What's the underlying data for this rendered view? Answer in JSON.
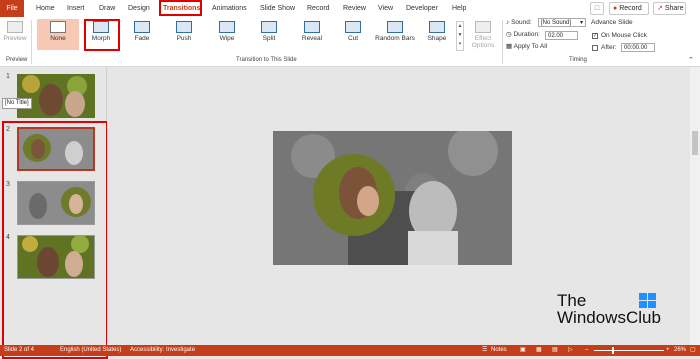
{
  "tabs": [
    "File",
    "Home",
    "Insert",
    "Draw",
    "Design",
    "Transitions",
    "Animations",
    "Slide Show",
    "Record",
    "Review",
    "View",
    "Developer",
    "Help"
  ],
  "top_right": {
    "comment_icon": "comment-icon",
    "record_label": "Record",
    "share_label": "Share"
  },
  "ribbon": {
    "preview_label": "Preview",
    "preview_group": "Preview",
    "transitions": [
      "None",
      "Morph",
      "Fade",
      "Push",
      "Wipe",
      "Split",
      "Reveal",
      "Cut",
      "Random Bars",
      "Shape"
    ],
    "effect_options": "Effect Options",
    "transition_group": "Transition to This Slide",
    "sound_label": "Sound:",
    "sound_value": "[No Sound]",
    "duration_label": "Duration:",
    "duration_value": "02.00",
    "apply_all": "Apply To All",
    "advance_label": "Advance Slide",
    "on_click_label": "On Mouse Click",
    "after_label": "After:",
    "after_value": "00:00.00",
    "timing_group": "Timing"
  },
  "thumbs": {
    "tooltip": "[No Title]",
    "numbers": [
      "1",
      "2",
      "3",
      "4"
    ]
  },
  "watermark": {
    "line1": "The",
    "line2": "WindowsClub"
  },
  "status": {
    "slide": "Slide 2 of 4",
    "language": "English (United States)",
    "accessibility": "Accessibility: Investigate",
    "notes": "Notes",
    "zoom": "26%"
  },
  "colors": {
    "accent": "#c43e1c",
    "highlight": "#e00000"
  }
}
